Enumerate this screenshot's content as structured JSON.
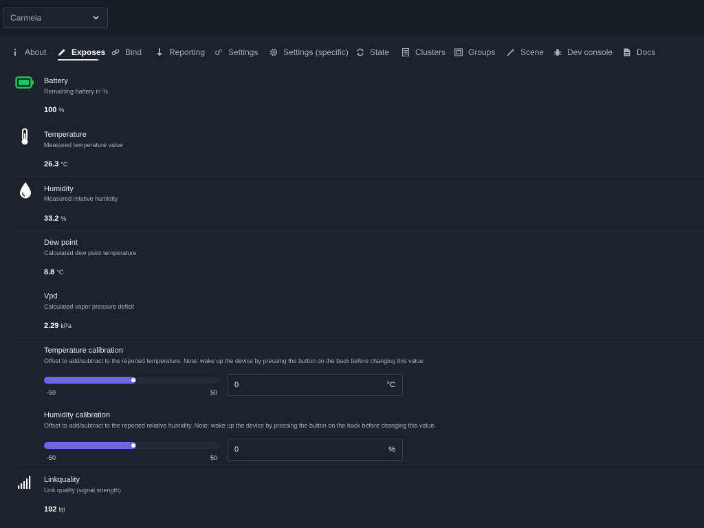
{
  "device_select": {
    "value": "Carmela"
  },
  "tabs": [
    {
      "label": "About",
      "icon": "info-icon"
    },
    {
      "label": "Exposes",
      "icon": "pencil-icon",
      "active": true
    },
    {
      "label": "Bind",
      "icon": "link-icon"
    },
    {
      "label": "Reporting",
      "icon": "arrow-down-icon"
    },
    {
      "label": "Settings",
      "icon": "gears-icon"
    },
    {
      "label": "Settings (specific)",
      "icon": "gear-icon"
    },
    {
      "label": "State",
      "icon": "sync-icon"
    },
    {
      "label": "Clusters",
      "icon": "list-icon"
    },
    {
      "label": "Groups",
      "icon": "groups-icon"
    },
    {
      "label": "Scene",
      "icon": "magic-wand-icon"
    },
    {
      "label": "Dev console",
      "icon": "bug-icon"
    },
    {
      "label": "Docs",
      "icon": "document-icon"
    }
  ],
  "exposes": {
    "battery": {
      "title": "Battery",
      "description": "Remaining battery in %",
      "value": "100",
      "unit": "%",
      "icon": "battery-icon"
    },
    "temperature": {
      "title": "Temperature",
      "description": "Measured temperature value",
      "value": "26.3",
      "unit": "°C",
      "icon": "thermometer-icon"
    },
    "humidity": {
      "title": "Humidity",
      "description": "Measured relative humidity",
      "value": "33.2",
      "unit": "%",
      "icon": "droplet-icon"
    },
    "dew_point": {
      "title": "Dew point",
      "description": "Calculated dew point temperature",
      "value": "8.8",
      "unit": "°C"
    },
    "vpd": {
      "title": "Vpd",
      "description": "Calculated vapor pressure deficit",
      "value": "2.29",
      "unit": "kPa"
    },
    "temperature_calibration": {
      "title": "Temperature calibration",
      "description": "Offset to add/subtract to the reported temperature. Note: wake up the device by pressing the button on the back before changing this value.",
      "min": "-50",
      "max": "50",
      "value": "0",
      "unit": "°C",
      "slider_value": 0
    },
    "humidity_calibration": {
      "title": "Humidity calibration",
      "description": "Offset to add/subtract to the reported relative humidity. Note: wake up the device by pressing the button on the back before changing this value.",
      "min": "-50",
      "max": "50",
      "value": "0",
      "unit": "%",
      "slider_value": 0
    },
    "linkquality": {
      "title": "Linkquality",
      "description": "Link quality (signal strength)",
      "value": "192",
      "unit": "lqi",
      "icon": "signal-icon"
    }
  },
  "colors": {
    "accent": "#6c63ff",
    "battery": "#22c55e",
    "background": "#1d232a"
  }
}
